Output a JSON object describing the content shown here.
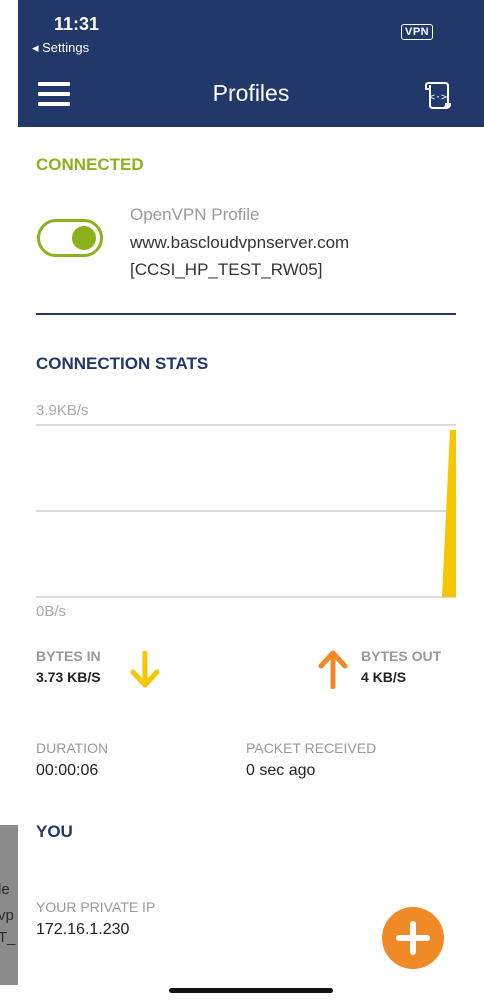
{
  "status_bar": {
    "time": "11:31",
    "back_label": "◂ Settings",
    "vpn_badge": "VPN"
  },
  "header": {
    "title": "Profiles"
  },
  "connection": {
    "status": "CONNECTED",
    "toggle_on": true,
    "profile_type": "OpenVPN Profile",
    "server": "www.bascloudvpnserver.com",
    "profile_name": "[CCSI_HP_TEST_RW05]"
  },
  "stats": {
    "title": "CONNECTION STATS",
    "y_max_label": "3.9KB/s",
    "y_min_label": "0B/s",
    "bytes_in_label": "BYTES IN",
    "bytes_in_value": "3.73 KB/S",
    "bytes_out_label": "BYTES OUT",
    "bytes_out_value": "4 KB/S",
    "duration_label": "DURATION",
    "duration_value": "00:00:06",
    "packet_label": "PACKET RECEIVED",
    "packet_value": "0 sec ago"
  },
  "you": {
    "title": "YOU",
    "private_ip_label": "YOUR PRIVATE IP",
    "private_ip_value": "172.16.1.230"
  },
  "background_peek": [
    "le",
    "vp",
    "T_"
  ],
  "colors": {
    "navy": "#22386a",
    "green": "#8cb21b",
    "yellow": "#f6c600",
    "orange": "#f08a27"
  }
}
